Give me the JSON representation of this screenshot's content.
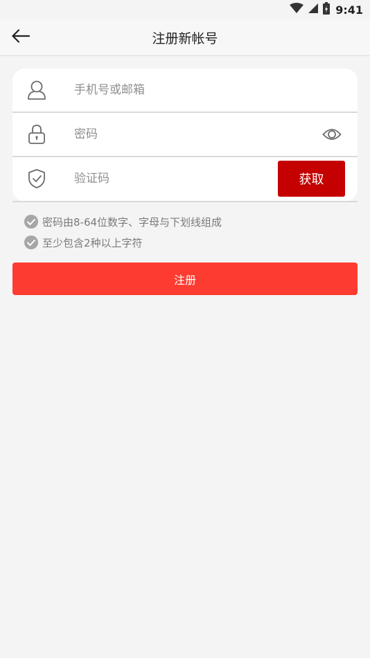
{
  "status_bar": {
    "time": "9:41",
    "icons": [
      "wifi-icon",
      "cellular-signal-icon",
      "battery-charging-icon"
    ]
  },
  "header": {
    "title": "注册新帐号",
    "back_icon": "back-arrow-icon"
  },
  "form": {
    "account": {
      "placeholder": "手机号或邮箱",
      "value": "",
      "icon": "user-icon"
    },
    "password": {
      "placeholder": "密码",
      "value": "",
      "icon": "lock-icon",
      "toggle_icon": "eye-icon"
    },
    "code": {
      "placeholder": "验证码",
      "value": "",
      "icon": "shield-check-icon",
      "button_label": "获取"
    }
  },
  "hints": [
    {
      "text": "密码由8-64位数字、字母与下划线组成",
      "icon": "check-circle-icon"
    },
    {
      "text": "至少包含2种以上字符",
      "icon": "check-circle-icon"
    }
  ],
  "register_button": {
    "label": "注册"
  },
  "colors": {
    "page_background": "#f4f4f4",
    "get_code_button": "#c40000",
    "register_button": "#fe3b30",
    "placeholder": "#8f8f8f",
    "hint_text": "#7a7a7a"
  }
}
